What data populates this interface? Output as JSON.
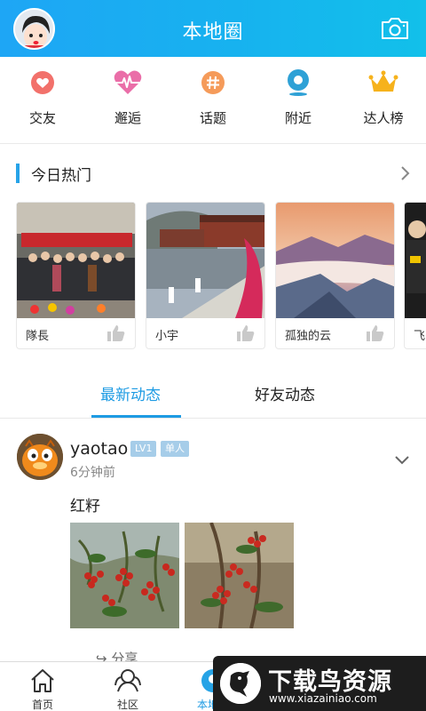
{
  "header": {
    "title": "本地圈"
  },
  "quicknav": [
    {
      "label": "交友",
      "icon": "heart-icon"
    },
    {
      "label": "邂逅",
      "icon": "heartbeat-icon"
    },
    {
      "label": "话题",
      "icon": "hashtag-icon"
    },
    {
      "label": "附近",
      "icon": "location-icon"
    },
    {
      "label": "达人榜",
      "icon": "crown-icon"
    }
  ],
  "hot": {
    "title": "今日热门",
    "cards": [
      {
        "name": "隊長"
      },
      {
        "name": "小宇"
      },
      {
        "name": "孤独的云"
      },
      {
        "name": "飞"
      }
    ]
  },
  "tabs": {
    "latest": "最新动态",
    "friends": "好友动态"
  },
  "post": {
    "username": "yaotao",
    "level": "LV1",
    "status": "单人",
    "time": "6分钟前",
    "text": "红籽",
    "share": "分享"
  },
  "bottombar": {
    "home": "首页",
    "community": "社区",
    "local": "本地圈"
  },
  "watermark": {
    "title": "下载鸟资源",
    "url": "www.xiazainiao.com"
  },
  "colors": {
    "header": "#1ea6f5",
    "accent": "#1e9be3",
    "badge": "#a6cde9"
  }
}
